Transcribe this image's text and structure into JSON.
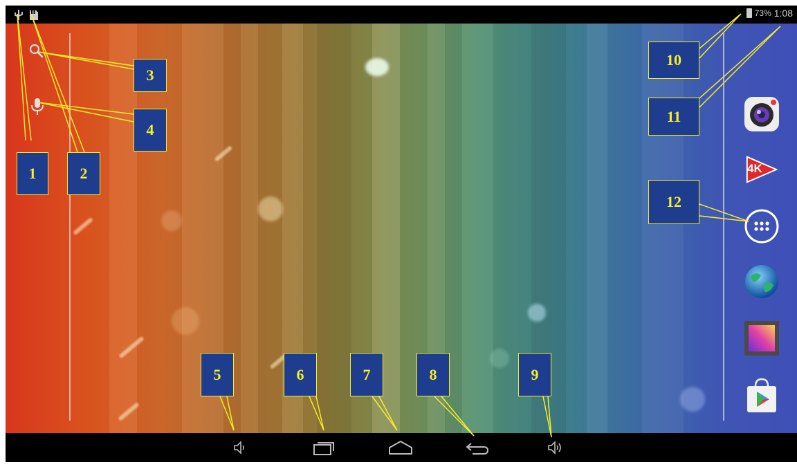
{
  "status_bar": {
    "battery_percent": "73%",
    "time": "1:08",
    "left_icons": [
      "usb-icon",
      "sd-card-icon"
    ]
  },
  "search_bar": {
    "icons": [
      "search-icon",
      "microphone-icon"
    ]
  },
  "dock_apps": [
    {
      "name": "camera-app",
      "icon": "camera-icon",
      "label": ""
    },
    {
      "name": "4k-player-app",
      "icon": "4k-icon",
      "label": "4K"
    },
    {
      "name": "app-drawer",
      "icon": "grid-icon",
      "label": ""
    },
    {
      "name": "browser-app",
      "icon": "globe-icon",
      "label": ""
    },
    {
      "name": "gallery-app",
      "icon": "gallery-icon",
      "label": ""
    },
    {
      "name": "play-store-app",
      "icon": "play-store-icon",
      "label": ""
    }
  ],
  "nav_bar": [
    "volume-down-icon",
    "recent-apps-icon",
    "home-icon",
    "back-icon",
    "volume-up-icon"
  ],
  "callouts": [
    "1",
    "2",
    "3",
    "4",
    "5",
    "6",
    "7",
    "8",
    "9",
    "10",
    "11",
    "12"
  ],
  "colors": {
    "callout_fill": "#1f3d8f",
    "callout_border": "#f5ee28",
    "callout_text": "#f5ee28"
  }
}
